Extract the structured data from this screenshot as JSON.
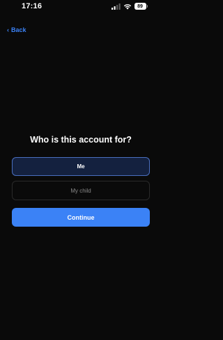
{
  "status_bar": {
    "time": "17:16",
    "battery": "89",
    "icons": [
      "signal-icon",
      "wifi-icon",
      "battery-icon"
    ]
  },
  "nav": {
    "back_label": "Back",
    "back_icon": "chevron-left-icon"
  },
  "main": {
    "question": "Who is this account for?",
    "options": [
      {
        "label": "Me",
        "selected": true
      },
      {
        "label": "My child",
        "selected": false
      }
    ],
    "continue_label": "Continue"
  },
  "colors": {
    "background": "#0a0a0a",
    "accent": "#3b82f6",
    "selected_fill": "#14213f",
    "selected_border": "#4a6fc0"
  }
}
